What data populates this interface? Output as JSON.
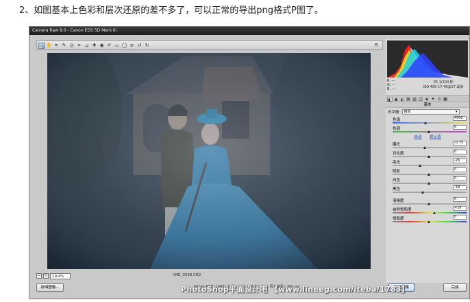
{
  "caption": "2、如图基本上色彩和层次还原的差不多了，可以正常的导出png格式P图了。",
  "window": {
    "title": "Camera Raw 9.0 - Canon EOS 5D Mark III"
  },
  "toolbar": {
    "tools": [
      {
        "name": "zoom-tool",
        "glyph": "🔍"
      },
      {
        "name": "hand-tool",
        "glyph": "✋"
      },
      {
        "name": "white-balance-tool",
        "glyph": "✒"
      },
      {
        "name": "color-sampler-tool",
        "glyph": "✎"
      },
      {
        "name": "targeted-adjustment-tool",
        "glyph": "◎"
      },
      {
        "name": "crop-tool",
        "glyph": "⌗"
      },
      {
        "name": "straighten-tool",
        "glyph": "⊿"
      },
      {
        "name": "spot-removal-tool",
        "glyph": "✚"
      },
      {
        "name": "red-eye-tool",
        "glyph": "◉"
      },
      {
        "name": "adjustment-brush-tool",
        "glyph": "✐"
      },
      {
        "name": "graduated-filter-tool",
        "glyph": "▭"
      },
      {
        "name": "radial-filter-tool",
        "glyph": "◯"
      },
      {
        "name": "preferences-tool",
        "glyph": "≡"
      },
      {
        "name": "rotate-ccw-tool",
        "glyph": "↺"
      },
      {
        "name": "rotate-cw-tool",
        "glyph": "↻"
      }
    ],
    "open_full_screen": "⇱"
  },
  "status": {
    "zoom": "19.4%",
    "filename": "IMG_3536.CR2"
  },
  "buttons": {
    "save_image": "存储图像...",
    "open_image": "打开图像",
    "done": "完成",
    "workflow_info": "Adobe RGB (1998); 8 位; 5760 x 3840 (22.1 百万像素); 300 ppi"
  },
  "panel": {
    "rgb": {
      "r": "R: ---",
      "g": "G: ---",
      "b": "B: ---"
    },
    "exif": {
      "aperture_shutter": "f/5    1/100 秒",
      "iso_lens": "ISO 400   17-40@17 毫米"
    },
    "tab_icons": [
      "◐",
      "▲",
      "◭",
      "▤",
      "▥",
      "◫",
      "◈",
      "✦",
      "⊙",
      "▦"
    ],
    "section_title": "基本",
    "white_balance": {
      "label": "白平衡",
      "value": "自定"
    },
    "auto": "自动",
    "default": "默认值",
    "sliders_wb": [
      {
        "label": "色温",
        "value": "4900",
        "pos": 0.45,
        "track": "temp"
      },
      {
        "label": "色调",
        "value": "0",
        "pos": 0.5,
        "track": "tint"
      }
    ],
    "sliders_tone": [
      {
        "label": "曝光",
        "value": "-0.75",
        "pos": 0.44
      },
      {
        "label": "对比度",
        "value": "0",
        "pos": 0.5
      },
      {
        "label": "高光",
        "value": "-26",
        "pos": 0.37
      },
      {
        "label": "阴影",
        "value": "0",
        "pos": 0.5
      },
      {
        "label": "白色",
        "value": "0",
        "pos": 0.5
      },
      {
        "label": "黑色",
        "value": "-18",
        "pos": 0.41
      }
    ],
    "sliders_presence": [
      {
        "label": "清晰度",
        "value": "0",
        "pos": 0.5,
        "track": "plain"
      },
      {
        "label": "自然饱和度",
        "value": "+16",
        "pos": 0.58,
        "track": "vib"
      },
      {
        "label": "饱和度",
        "value": "0",
        "pos": 0.5,
        "track": "sat"
      }
    ]
  },
  "watermark": "PhotoShop平面设计吧 【www.lineeg.com/iteba/1783】"
}
